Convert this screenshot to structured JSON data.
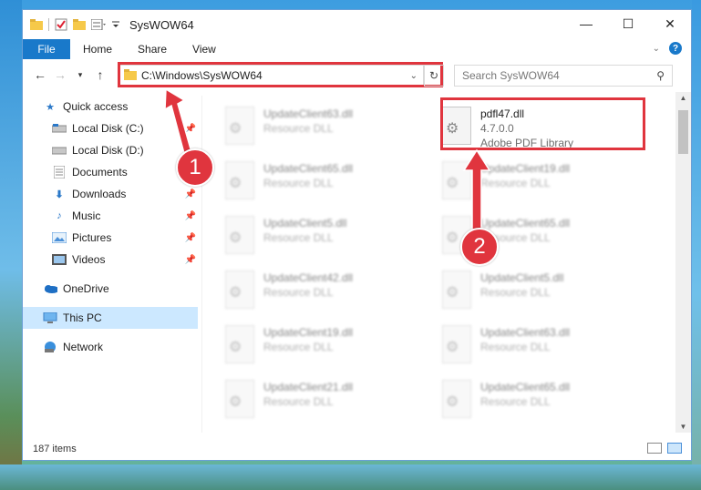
{
  "window": {
    "title": "SysWOW64"
  },
  "ribbon": {
    "tabs": [
      "File",
      "Home",
      "Share",
      "View"
    ],
    "help": "?"
  },
  "address": {
    "path": "C:\\Windows\\SysWOW64"
  },
  "search": {
    "placeholder": "Search SysWOW64"
  },
  "sidebar": {
    "items": [
      {
        "label": "Quick access",
        "icon": "star-icon"
      },
      {
        "label": "Local Disk (C:)",
        "icon": "drive-icon"
      },
      {
        "label": "Local Disk (D:)",
        "icon": "drive-icon"
      },
      {
        "label": "Documents",
        "icon": "documents-icon"
      },
      {
        "label": "Downloads",
        "icon": "download-icon"
      },
      {
        "label": "Music",
        "icon": "music-icon"
      },
      {
        "label": "Pictures",
        "icon": "pictures-icon"
      },
      {
        "label": "Videos",
        "icon": "videos-icon"
      },
      {
        "label": "OneDrive",
        "icon": "cloud-icon"
      },
      {
        "label": "This PC",
        "icon": "computer-icon"
      },
      {
        "label": "Network",
        "icon": "network-icon"
      }
    ]
  },
  "files": {
    "highlighted": {
      "name": "pdfl47.dll",
      "version": "4.7.0.0",
      "description": "Adobe PDF Library"
    },
    "left_column": [
      {
        "name": "UpdateClient63.dll",
        "desc": "Resource DLL"
      },
      {
        "name": "UpdateClient65.dll",
        "desc": "Resource DLL"
      },
      {
        "name": "UpdateClient5.dll",
        "desc": "Resource DLL"
      },
      {
        "name": "UpdateClient42.dll",
        "desc": "Resource DLL"
      },
      {
        "name": "UpdateClient19.dll",
        "desc": "Resource DLL"
      },
      {
        "name": "UpdateClient21.dll",
        "desc": "Resource DLL"
      }
    ],
    "right_column": [
      {
        "name": "UpdateClient19.dll",
        "desc": "Resource DLL"
      },
      {
        "name": "UpdateClient65.dll",
        "desc": "Resource DLL"
      },
      {
        "name": "UpdateClient5.dll",
        "desc": "Resource DLL"
      },
      {
        "name": "UpdateClient63.dll",
        "desc": "Resource DLL"
      },
      {
        "name": "UpdateClient65.dll",
        "desc": "Resource DLL"
      }
    ]
  },
  "status": {
    "count": "187 items"
  },
  "annotations": {
    "step1": "1",
    "step2": "2",
    "color": "#e0353e"
  }
}
